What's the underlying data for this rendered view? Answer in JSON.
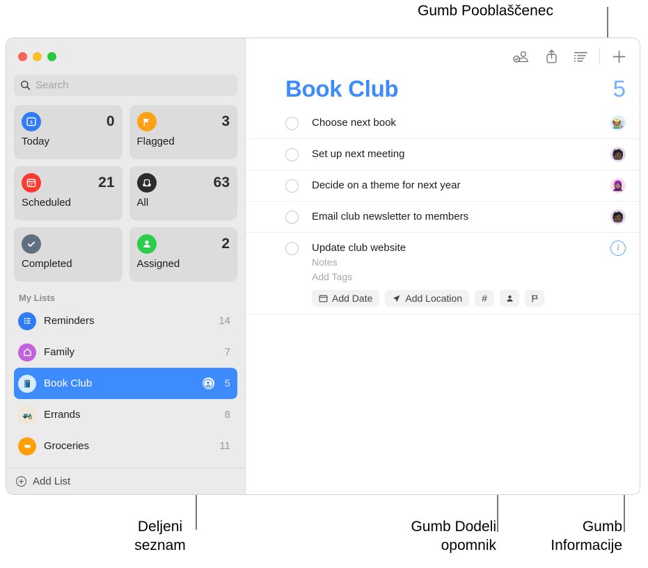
{
  "annotations": {
    "top": "Gumb Pooblaščenec",
    "shared_list": "Deljeni\nseznam",
    "assign_button": "Gumb Dodeli\nopomnik",
    "info_button": "Gumb\nInformacije"
  },
  "window": {
    "traffic_lights": [
      "close",
      "minimize",
      "zoom"
    ]
  },
  "sidebar": {
    "search": {
      "placeholder": "Search",
      "value": ""
    },
    "smart_lists": [
      {
        "id": "today",
        "label": "Today",
        "count": "0",
        "icon": "calendar-day-icon",
        "color": "#2f7cf6"
      },
      {
        "id": "flagged",
        "label": "Flagged",
        "count": "3",
        "icon": "flag-icon",
        "color": "#ffa114"
      },
      {
        "id": "scheduled",
        "label": "Scheduled",
        "count": "21",
        "icon": "calendar-icon",
        "color": "#fb3b30"
      },
      {
        "id": "all",
        "label": "All",
        "count": "63",
        "icon": "inbox-tray-icon",
        "color": "#2c2c2e"
      },
      {
        "id": "completed",
        "label": "Completed",
        "count": "",
        "icon": "checkmark-icon",
        "color": "#5f7080"
      },
      {
        "id": "assigned",
        "label": "Assigned",
        "count": "2",
        "icon": "person-icon",
        "color": "#2ccd4b"
      }
    ],
    "my_lists_header": "My Lists",
    "lists": [
      {
        "label": "Reminders",
        "count": "14",
        "icon": "bulleted-list-icon",
        "color": "#2f7cf6",
        "shared": false,
        "selected": false
      },
      {
        "label": "Family",
        "count": "7",
        "icon": "house-icon",
        "color": "#c163dd",
        "shared": false,
        "selected": false
      },
      {
        "label": "Book Club",
        "count": "5",
        "icon": "book-icon",
        "color": "#d9ecff",
        "shared": true,
        "selected": true
      },
      {
        "label": "Errands",
        "count": "8",
        "icon": "pickup-truck-icon",
        "color": "#efe7da",
        "shared": false,
        "selected": false
      },
      {
        "label": "Groceries",
        "count": "11",
        "icon": "shopping-cart-icon",
        "color": "#ff9f0a",
        "shared": false,
        "selected": false
      }
    ],
    "add_list": {
      "label": "Add List",
      "icon": "plus-circle-icon"
    }
  },
  "main": {
    "toolbar": [
      {
        "id": "delegate",
        "icon": "person-badge-check-icon"
      },
      {
        "id": "share",
        "icon": "share-icon"
      },
      {
        "id": "list-format",
        "icon": "list-format-icon"
      },
      {
        "id": "add",
        "icon": "plus-icon"
      }
    ],
    "title": "Book Club",
    "total": "5",
    "title_color": "#3d8bfd",
    "reminders": [
      {
        "title": "Choose next book",
        "avatar": "🧑🏽‍🌾",
        "avatar_bg": "#d8eeff",
        "right": "avatar"
      },
      {
        "title": "Set up next meeting",
        "avatar": "🧑🏿",
        "avatar_bg": "#e3d7f2",
        "right": "avatar"
      },
      {
        "title": "Decide on a theme for next year",
        "avatar": "🧕🏽",
        "avatar_bg": "#ffd9e8",
        "right": "avatar"
      },
      {
        "title": "Email club newsletter to members",
        "avatar": "🧑🏿",
        "avatar_bg": "#e3d7f2",
        "right": "avatar"
      },
      {
        "title": "Update club website",
        "avatar": "",
        "avatar_bg": "",
        "right": "info",
        "notes_placeholder": "Notes",
        "tags_placeholder": "Add Tags",
        "actions": [
          {
            "id": "add-date",
            "label": "Add Date",
            "icon": "calendar-icon"
          },
          {
            "id": "add-location",
            "label": "Add Location",
            "icon": "location-arrow-icon"
          },
          {
            "id": "add-tag",
            "label": "#",
            "icon": "hash-icon"
          },
          {
            "id": "assign",
            "label": "",
            "icon": "person-fill-icon"
          },
          {
            "id": "flag",
            "label": "",
            "icon": "flag-outline-icon"
          }
        ]
      }
    ]
  }
}
